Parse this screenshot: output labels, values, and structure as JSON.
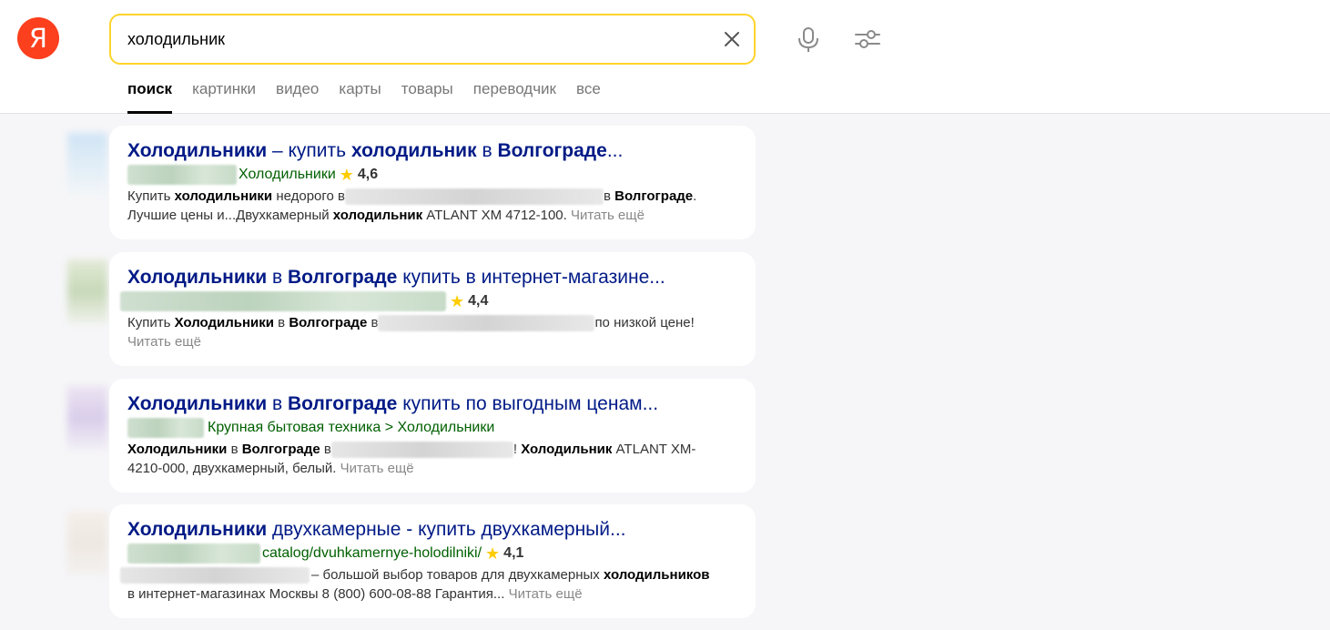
{
  "header": {
    "logo_letter": "Я",
    "search": {
      "value": "холодильник"
    },
    "tabs": [
      "поиск",
      "картинки",
      "видео",
      "карты",
      "товары",
      "переводчик",
      "все"
    ]
  },
  "results": [
    {
      "title_parts": [
        {
          "t": "Холодильники",
          "b": true
        },
        {
          "t": " – купить ",
          "b": false
        },
        {
          "t": "холодильник",
          "b": true
        },
        {
          "t": " в ",
          "b": false
        },
        {
          "t": "Волгограде",
          "b": true
        },
        {
          "t": "...",
          "b": false
        }
      ],
      "path": "Холодильники",
      "rating": "4,6",
      "snippet1_a": "Купить ",
      "snippet1_b": "холодильники",
      "snippet1_c": " недорого в",
      "snippet1_d": "в ",
      "snippet1_e": "Волгограде",
      "snippet1_f": ".",
      "snippet2_a": "Лучшие цены и...Двухкамерный ",
      "snippet2_b": "холодильник",
      "snippet2_c": " ATLANT ХМ 4712-100. ",
      "more": "Читать ещё"
    },
    {
      "title_parts": [
        {
          "t": "Холодильники",
          "b": true
        },
        {
          "t": " в ",
          "b": false
        },
        {
          "t": "Волгограде",
          "b": true
        },
        {
          "t": " купить в интернет-магазине...",
          "b": false
        }
      ],
      "rating": "4,4",
      "snippet1_a": "Купить ",
      "snippet1_b": "Холодильники",
      "snippet1_c": " в ",
      "snippet1_d": "Волгограде",
      "snippet1_e": " в",
      "snippet1_f": "по низкой цене!",
      "more": "Читать ещё"
    },
    {
      "title_parts": [
        {
          "t": "Холодильники",
          "b": true
        },
        {
          "t": " в ",
          "b": false
        },
        {
          "t": "Волгограде",
          "b": true
        },
        {
          "t": " купить по выгодным ценам...",
          "b": false
        }
      ],
      "path": "Крупная бытовая техника > Холодильники",
      "snippet1_a": "Холодильники",
      "snippet1_b": " в ",
      "snippet1_c": "Волгограде",
      "snippet1_d": " в",
      "snippet1_e": "! ",
      "snippet1_f": "Холодильник",
      "snippet1_g": " ATLANT ХМ-",
      "snippet2_a": "4210-000, двухкамерный, белый. ",
      "more": "Читать ещё"
    },
    {
      "title_parts": [
        {
          "t": "Холодильники",
          "b": true
        },
        {
          "t": " двухкамерные - купить двухкамерный...",
          "b": false
        }
      ],
      "path": "catalog/dvuhkamernye-holodilniki/",
      "rating": "4,1",
      "snippet1_a": "– большой выбор товаров для двухкамерных ",
      "snippet1_b": "холодильников",
      "snippet2_a": "в интернет-магазинах Москвы 8 (800) 600-08-88 Гарантия... ",
      "more": "Читать ещё"
    }
  ],
  "colors": {
    "logo": "#fc3f1d",
    "search_border": "#fed42b",
    "title": "#001a86",
    "url_green": "#006000",
    "star": "#ffcc00",
    "background": "#f6f6f8"
  },
  "icons": [
    "yandex-logo",
    "clear-icon",
    "microphone-icon",
    "filter-settings-icon",
    "star-icon"
  ]
}
